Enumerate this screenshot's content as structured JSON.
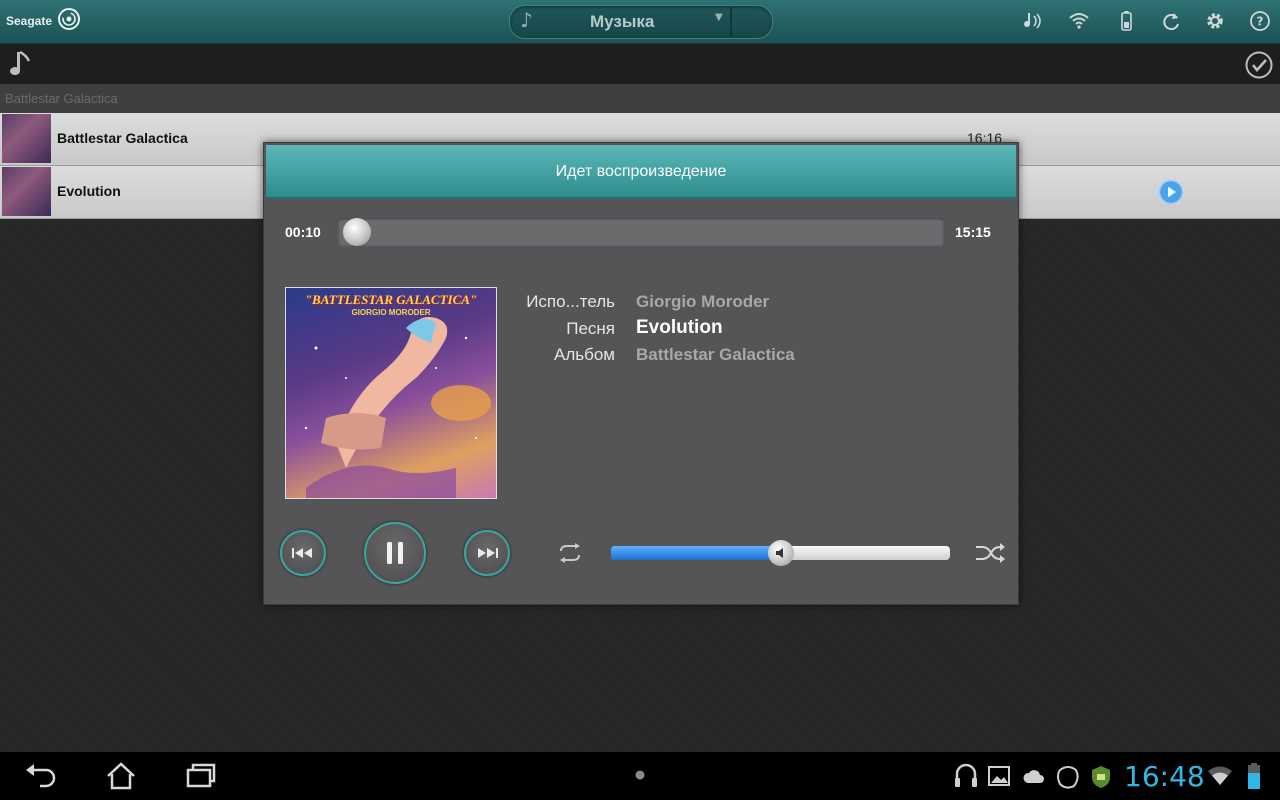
{
  "app": {
    "brand": "Seagate",
    "category": "Музыка"
  },
  "breadcrumb": "Battlestar Galactica",
  "list": [
    {
      "title": "Battlestar Galactica",
      "duration": "16:16"
    },
    {
      "title": "Evolution",
      "duration": ""
    }
  ],
  "player": {
    "title": "Идет воспроизведение",
    "elapsed": "00:10",
    "total": "15:15",
    "progress_fraction": 0.011,
    "cover": {
      "title_text": "\"BATTLESTAR GALACTICA\"",
      "artist_text": "GIORGIO MORODER"
    },
    "labels": {
      "artist": "Испо...тель",
      "song": "Песня",
      "album": "Альбом"
    },
    "values": {
      "artist": "Giorgio Moroder",
      "song": "Evolution",
      "album": "Battlestar Galactica"
    },
    "volume_fraction": 0.5
  },
  "status": {
    "time": "16:48"
  },
  "colors": {
    "accent": "#2e8c8d",
    "clock": "#33b5e5",
    "volume": "#1c6fd0"
  }
}
